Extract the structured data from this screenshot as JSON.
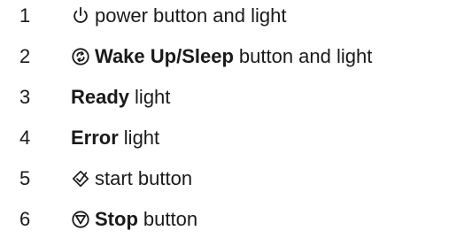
{
  "legend": {
    "items": [
      {
        "number": "1",
        "icon": "power-icon",
        "bold": "",
        "text": "power button and light"
      },
      {
        "number": "2",
        "icon": "wake-sleep-icon",
        "bold": "Wake Up/Sleep",
        "text": "button and light"
      },
      {
        "number": "3",
        "icon": "",
        "bold": "Ready",
        "text": "light"
      },
      {
        "number": "4",
        "icon": "",
        "bold": "Error",
        "text": "light"
      },
      {
        "number": "5",
        "icon": "start-icon",
        "bold": "",
        "text": "start button"
      },
      {
        "number": "6",
        "icon": "stop-icon",
        "bold": "Stop",
        "text": "button"
      }
    ]
  }
}
